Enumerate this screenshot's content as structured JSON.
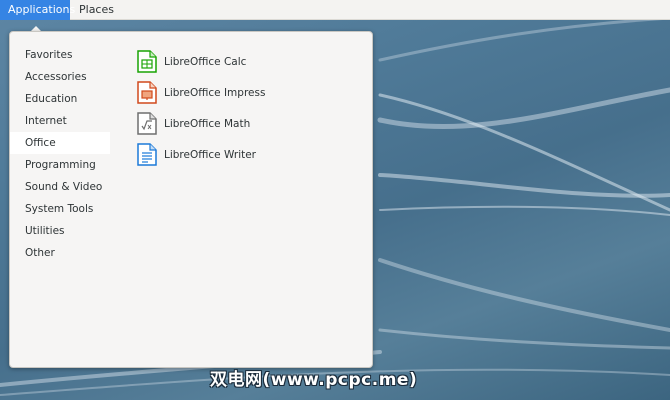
{
  "topbar": {
    "applications_label": "Applications",
    "places_label": "Places"
  },
  "menu": {
    "categories": [
      {
        "label": "Favorites"
      },
      {
        "label": "Accessories"
      },
      {
        "label": "Education"
      },
      {
        "label": "Internet"
      },
      {
        "label": "Office",
        "selected": true
      },
      {
        "label": "Programming"
      },
      {
        "label": "Sound & Video"
      },
      {
        "label": "System Tools"
      },
      {
        "label": "Utilities"
      },
      {
        "label": "Other"
      }
    ],
    "apps": [
      {
        "label": "LibreOffice Calc",
        "icon": "libreoffice-calc-icon",
        "color": "#18a303"
      },
      {
        "label": "LibreOffice Impress",
        "icon": "libreoffice-impress-icon",
        "color": "#d0491c"
      },
      {
        "label": "LibreOffice Math",
        "icon": "libreoffice-math-icon",
        "color": "#6e6e6e"
      },
      {
        "label": "LibreOffice Writer",
        "icon": "libreoffice-writer-icon",
        "color": "#1c7ad8"
      }
    ]
  },
  "watermark": "双电网(www.pcpc.me)",
  "colors": {
    "accent": "#3584e4",
    "popup_bg": "#f6f5f4",
    "selected_bg": "#ffffff"
  }
}
